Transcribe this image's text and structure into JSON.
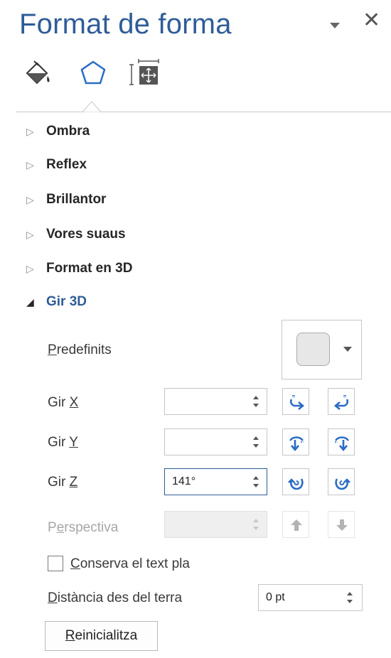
{
  "pane": {
    "title": "Format de forma",
    "dropdown_icon": "chevron-down-icon",
    "close_icon": "close-icon",
    "close_glyph": "✕"
  },
  "tabs": [
    {
      "name": "fill-line",
      "icon": "paint-bucket-icon"
    },
    {
      "name": "effects",
      "icon": "pentagon-icon",
      "selected": true
    },
    {
      "name": "layout-properties",
      "icon": "size-properties-icon"
    }
  ],
  "sections": [
    {
      "label": "Ombra",
      "expanded": false
    },
    {
      "label": "Reflex",
      "expanded": false
    },
    {
      "label": "Brillantor",
      "expanded": false
    },
    {
      "label": "Vores suaus",
      "expanded": false
    },
    {
      "label": "Format en 3D",
      "expanded": false
    },
    {
      "label": "Gir 3D",
      "expanded": true
    }
  ],
  "arrows": {
    "collapsed": "▷",
    "expanded": "◢"
  },
  "rotation": {
    "presets": {
      "label_first": "P",
      "label_rest": "redefinits"
    },
    "x": {
      "label_pre": "Gir ",
      "label_key": "X",
      "value": ""
    },
    "y": {
      "label_pre": "Gir ",
      "label_key": "Y",
      "value": ""
    },
    "z": {
      "label_pre": "Gir ",
      "label_key": "Z",
      "value": "141°"
    },
    "perspective": {
      "label_pre": "P",
      "label_key": "e",
      "label_post": "rspectiva",
      "value": "",
      "enabled": false
    },
    "keep_text_flat": {
      "label_key": "C",
      "label_rest": "onserva el text pla",
      "checked": false
    },
    "distance": {
      "label_key": "D",
      "label_rest": "istància des del terra",
      "value": "0 pt"
    },
    "reset": {
      "label_key": "R",
      "label_rest": "einicialitza"
    }
  },
  "colors": {
    "accent": "#2e5c97",
    "icon_blue": "#2b6cc4"
  }
}
